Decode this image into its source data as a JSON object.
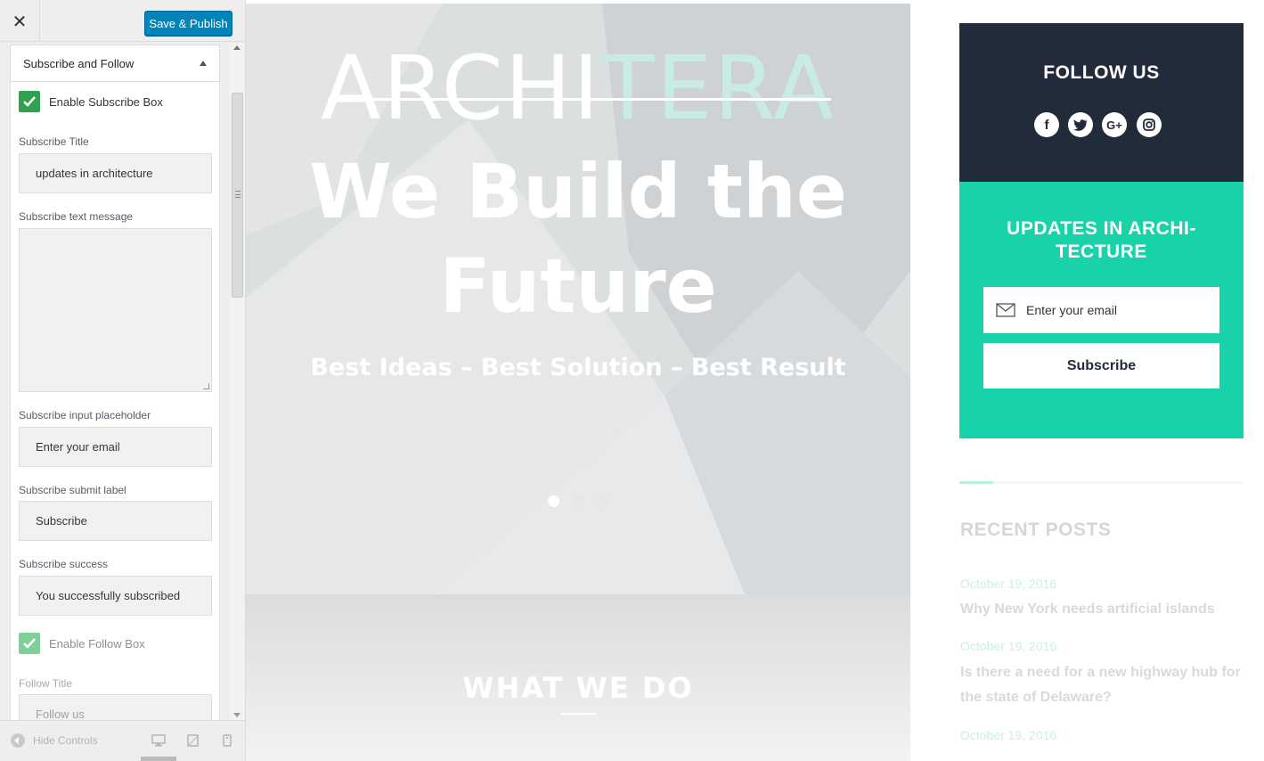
{
  "customizer": {
    "close_icon": "close-icon",
    "save_label": "Save & Publish",
    "section_title": "Subscribe and Follow",
    "enable_subscribe_label": "Enable Subscribe Box",
    "subscribe_title_label": "Subscribe Title",
    "subscribe_title_value": "updates in architecture",
    "subscribe_text_label": "Subscribe text message",
    "subscribe_text_value": "",
    "placeholder_label": "Subscribe input placeholder",
    "placeholder_value": "Enter your email",
    "submit_label_label": "Subscribe submit label",
    "submit_label_value": "Subscribe",
    "success_label": "Subscribe success",
    "success_value": "You successfully subscribed",
    "enable_follow_label": "Enable Follow Box",
    "follow_title_label": "Follow Title",
    "follow_title_value": "Follow us",
    "hide_controls": "Hide Controls",
    "colors": {
      "primary": "#0085ba",
      "checkbox": "#2ea24f"
    }
  },
  "preview": {
    "logo_a": "ARCHI",
    "logo_b": "TERA",
    "hero_title": "We Build the Future",
    "hero_subtitle": "Best Ideas – Best Solution – Best Result",
    "slider_dots": 3,
    "section_heading": "WHAT WE DO",
    "sidebar": {
      "follow_title": "FOLLOW US",
      "social_icons": [
        "facebook-icon",
        "twitter-icon",
        "google-plus-icon",
        "instagram-icon"
      ],
      "subscribe_title": "UPDATES IN ARCHI-TECTURE",
      "email_placeholder": "Enter your email",
      "subscribe_button": "Subscribe",
      "recent_posts_title": "RECENT POSTS",
      "posts": [
        {
          "date": "October 19, 2016",
          "title": "Why New York needs artificial islands"
        },
        {
          "date": "October 19, 2016",
          "title": "Is there a need for a new highway hub for the state of Delaware?"
        },
        {
          "date": "October 19, 2016",
          "title": ""
        }
      ],
      "colors": {
        "dark": "#222b3a",
        "accent": "#18d3a9"
      }
    }
  }
}
